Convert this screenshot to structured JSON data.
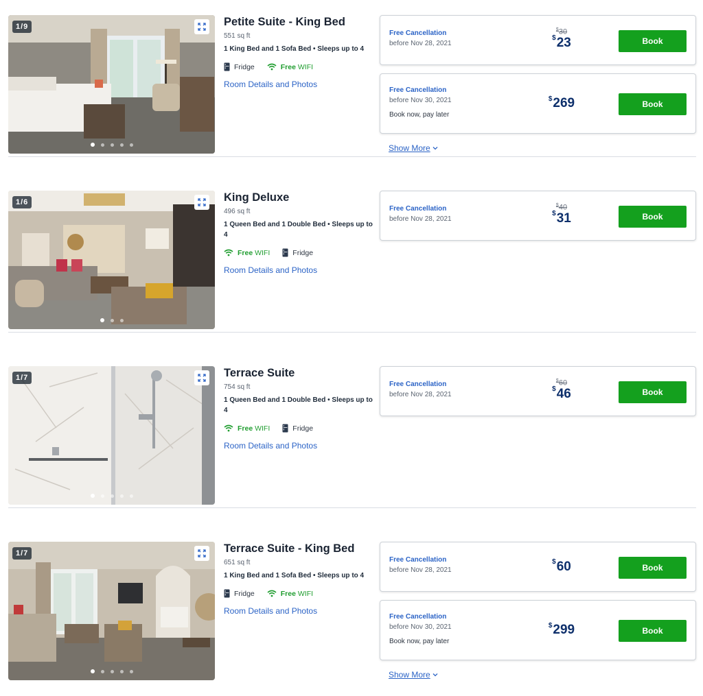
{
  "rooms": [
    {
      "title": "Petite Suite - King Bed",
      "counter": "1/9",
      "sqft": "551 sq ft",
      "beds": "1 King Bed and 1 Sofa Bed  •  Sleeps up to 4",
      "amenities": [
        {
          "icon": "fridge-icon",
          "label": "Fridge",
          "bold": ""
        },
        {
          "icon": "wifi-icon",
          "label": "WIFI",
          "bold": "Free"
        }
      ],
      "details_link": "Room Details and Photos",
      "rates": [
        {
          "cancel": "Free Cancellation",
          "before": "before Nov 28, 2021",
          "paylater": "",
          "orig_currency": "$",
          "orig": "30",
          "currency": "$",
          "price": "23",
          "book": "Book"
        },
        {
          "cancel": "Free Cancellation",
          "before": "before Nov 30, 2021",
          "paylater": "Book now, pay later",
          "orig_currency": "",
          "orig": "",
          "currency": "$",
          "price": "269",
          "book": "Book"
        }
      ],
      "show_more": "Show More",
      "dots": 5
    },
    {
      "title": "King Deluxe",
      "counter": "1/6",
      "sqft": "496 sq ft",
      "beds": "1 Queen Bed and 1 Double Bed  •  Sleeps up to 4",
      "amenities": [
        {
          "icon": "wifi-icon",
          "label": "WIFI",
          "bold": "Free"
        },
        {
          "icon": "fridge-icon",
          "label": "Fridge",
          "bold": ""
        }
      ],
      "details_link": "Room Details and Photos",
      "rates": [
        {
          "cancel": "Free Cancellation",
          "before": "before Nov 28, 2021",
          "paylater": "",
          "orig_currency": "$",
          "orig": "40",
          "currency": "$",
          "price": "31",
          "book": "Book"
        }
      ],
      "show_more": "",
      "dots": 3
    },
    {
      "title": "Terrace Suite",
      "counter": "1/7",
      "sqft": "754 sq ft",
      "beds": "1 Queen Bed and 1 Double Bed  •  Sleeps up to 4",
      "amenities": [
        {
          "icon": "wifi-icon",
          "label": "WIFI",
          "bold": "Free"
        },
        {
          "icon": "fridge-icon",
          "label": "Fridge",
          "bold": ""
        }
      ],
      "details_link": "Room Details and Photos",
      "rates": [
        {
          "cancel": "Free Cancellation",
          "before": "before Nov 28, 2021",
          "paylater": "",
          "orig_currency": "$",
          "orig": "60",
          "currency": "$",
          "price": "46",
          "book": "Book"
        }
      ],
      "show_more": "",
      "dots": 5
    },
    {
      "title": "Terrace Suite - King Bed",
      "counter": "1/7",
      "sqft": "651 sq ft",
      "beds": "1 King Bed and 1 Sofa Bed  •  Sleeps up to 4",
      "amenities": [
        {
          "icon": "fridge-icon",
          "label": "Fridge",
          "bold": ""
        },
        {
          "icon": "wifi-icon",
          "label": "WIFI",
          "bold": "Free"
        }
      ],
      "details_link": "Room Details and Photos",
      "rates": [
        {
          "cancel": "Free Cancellation",
          "before": "before Nov 28, 2021",
          "paylater": "",
          "orig_currency": "",
          "orig": "",
          "currency": "$",
          "price": "60",
          "book": "Book"
        },
        {
          "cancel": "Free Cancellation",
          "before": "before Nov 30, 2021",
          "paylater": "Book now, pay later",
          "orig_currency": "",
          "orig": "",
          "currency": "$",
          "price": "299",
          "book": "Book"
        }
      ],
      "show_more": "Show More",
      "dots": 5
    }
  ],
  "colors": {
    "book_button": "#14a01e",
    "link": "#2b63c6",
    "price": "#0d2f6b",
    "wifi": "#1f9d2f"
  }
}
